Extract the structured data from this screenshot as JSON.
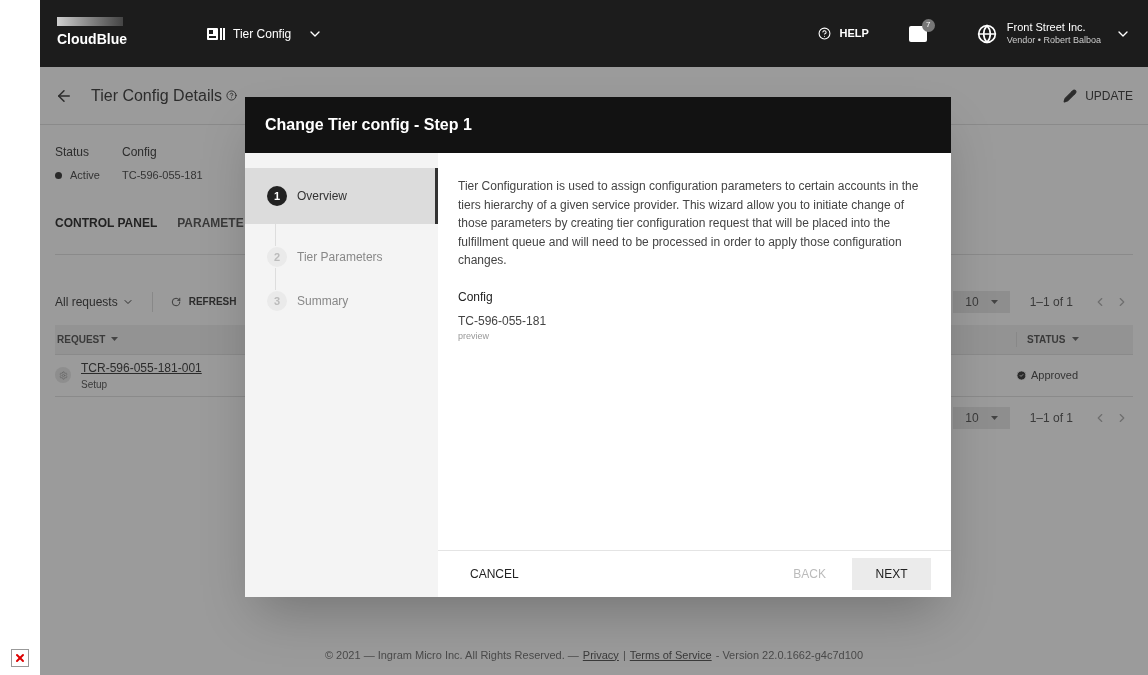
{
  "topbar": {
    "logo": "CloudBlue",
    "module": "Tier Config",
    "help": "HELP",
    "notifications_badge": "7",
    "account": {
      "name": "Front Street Inc.",
      "role": "Vendor • Robert Balboa"
    }
  },
  "page": {
    "title": "Tier Config Details",
    "update": "UPDATE",
    "fields": [
      {
        "label": "Status",
        "value": "Active"
      },
      {
        "label": "Config",
        "value": "TC-596-055-181"
      }
    ],
    "tabs": [
      {
        "label": "CONTROL PANEL",
        "selected": true
      },
      {
        "label": "PARAMETE",
        "selected": false
      }
    ],
    "filter": "All requests",
    "refresh": "REFRESH",
    "pagination_top": {
      "per_page": "10",
      "range": "1–1 of 1"
    },
    "pagination_bottom": {
      "per_page": "10",
      "range": "1–1 of 1"
    },
    "table": {
      "columns": [
        "REQUEST",
        "STATUS"
      ],
      "rows": [
        {
          "request": "TCR-596-055-181-001",
          "type": "Setup",
          "status": "Approved"
        }
      ]
    },
    "footer": {
      "copyright": "© 2021 — Ingram Micro Inc. All Rights Reserved. —",
      "privacy": "Privacy",
      "separator": "|",
      "terms": "Terms of Service",
      "version": "- Version 22.0.1662-g4c7d100"
    }
  },
  "dialog": {
    "title": "Change Tier config - Step 1",
    "steps": [
      {
        "number": "1",
        "label": "Overview",
        "selected": true
      },
      {
        "number": "2",
        "label": "Tier Parameters",
        "selected": false
      },
      {
        "number": "3",
        "label": "Summary",
        "selected": false
      }
    ],
    "description": "Tier Configuration is used to assign configuration parameters to certain accounts in the tiers hierarchy of a given service provider. This wizard allow you to initiate change of those parameters by creating tier configuration request that will be placed into the fulfillment queue and will need to be processed in order to apply those configuration changes.",
    "config_label": "Config",
    "config_value": "TC-596-055-181",
    "config_hint": "preview",
    "buttons": [
      {
        "label": "CANCEL",
        "disabled": false,
        "primary": false
      },
      {
        "label": "BACK",
        "disabled": true,
        "primary": false
      },
      {
        "label": "NEXT",
        "disabled": false,
        "primary": true
      }
    ]
  }
}
